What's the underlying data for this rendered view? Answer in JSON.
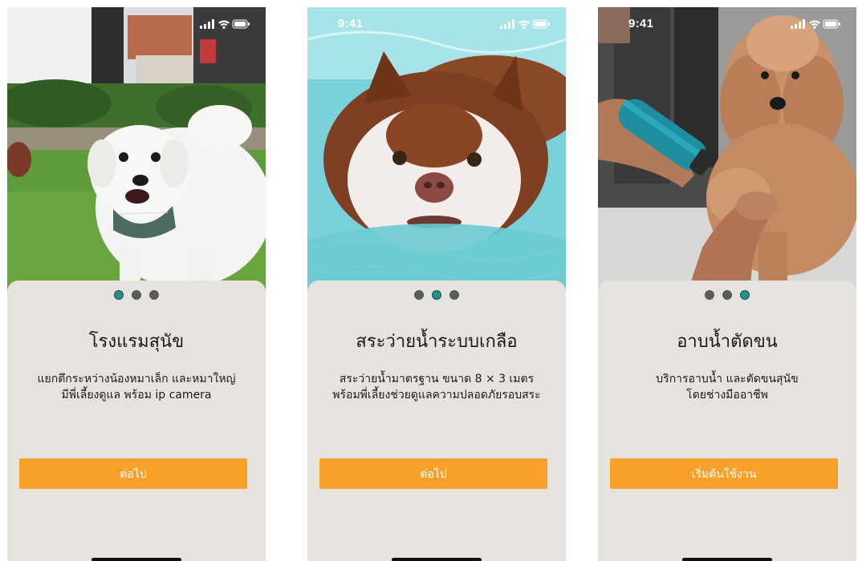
{
  "colors": {
    "accent": "#f7a02a",
    "dot_active": "#2a8b89",
    "dot_inactive": "#5a5a5a",
    "card_bg": "#e6e3de"
  },
  "screens": [
    {
      "status_time": "",
      "photo": "white-dog-on-lawn",
      "active_dot": 1,
      "title": "โรงแรมสุนัข",
      "description": [
        "แยกตึกระหว่างน้องหมาเล็ก และหมาใหญ่",
        "มีพี่เลี้ยงดูแล พร้อม ip camera"
      ],
      "button_label": "ต่อไป"
    },
    {
      "status_time": "9:41",
      "photo": "husky-swimming",
      "active_dot": 2,
      "title": "สระว่ายน้ำระบบเกลือ",
      "description": [
        "สระว่ายน้ำมาตรฐาน ขนาด 8 × 3 เมตร",
        "พร้อมพี่เลี้ยงช่วยดูแลความปลอดภัยรอบสระ"
      ],
      "button_label": "ต่อไป"
    },
    {
      "status_time": "9:41",
      "photo": "poodle-grooming",
      "active_dot": 3,
      "title": "อาบน้ำตัดขน",
      "description": [
        "บริการอาบน้ำ และตัดขนสุนัข",
        "โดยช่างมืออาชีพ"
      ],
      "button_label": "เริ่มต้นใช้งาน"
    }
  ],
  "icons": [
    "cellular-signal-icon",
    "wifi-icon",
    "battery-icon"
  ]
}
